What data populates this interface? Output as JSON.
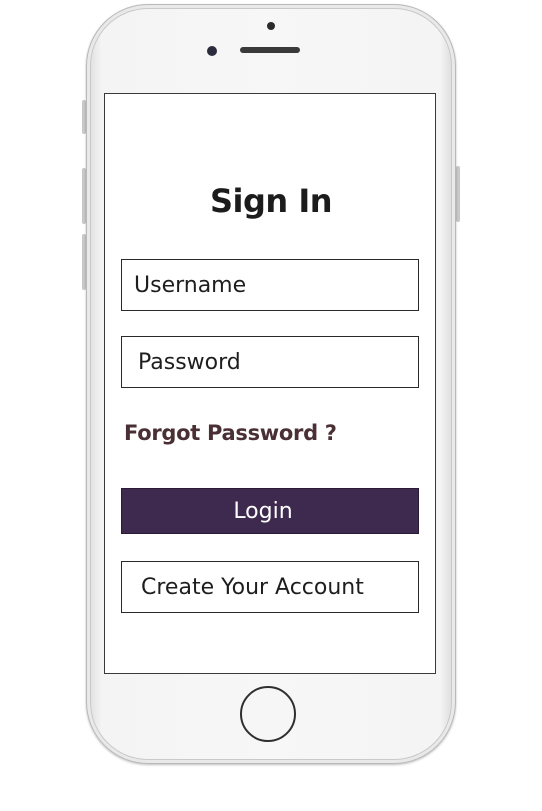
{
  "screen": {
    "title": "Sign In",
    "username": {
      "placeholder": "Username"
    },
    "password": {
      "placeholder": "Password"
    },
    "forgot_password_label": "Forgot Password ?",
    "login_label": "Login",
    "create_account_label": "Create Your Account"
  },
  "colors": {
    "login_button_bg": "#3e2a4f",
    "forgot_link_text": "#4a3034",
    "phone_body": "#f4f4f4"
  },
  "icons": {
    "home": "home-button-icon",
    "camera": "front-camera-icon",
    "speaker": "speaker-icon"
  }
}
